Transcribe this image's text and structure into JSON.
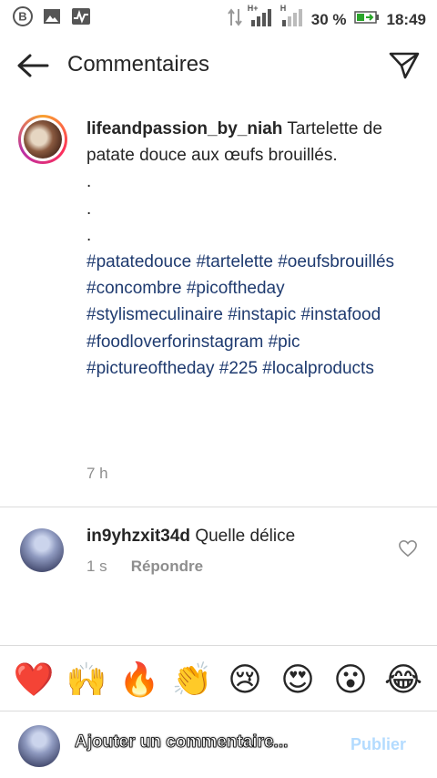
{
  "status_bar": {
    "battery_percent": "30 %",
    "time": "18:49",
    "network_1": "H+",
    "network_2": "H"
  },
  "header": {
    "title": "Commentaires"
  },
  "post": {
    "username": "lifeandpassion_by_niah",
    "caption": "Tartelette de patate douce aux œufs brouillés.",
    "dots": [
      ".",
      ".",
      "."
    ],
    "hashtags": "#patatedouce #tartelette #oeufsbrouillés #concombre #picoftheday #stylismeculinaire #instapic #instafood #foodloverforinstagram #pic #pictureoftheday #225 #localproducts",
    "time": "7 h"
  },
  "comment": {
    "username": "in9yhzxit34d",
    "text": "Quelle délice",
    "time": "1 s",
    "reply_label": "Répondre"
  },
  "emoji_bar": [
    "❤️",
    "🙌",
    "🔥",
    "👏",
    "😢",
    "😍",
    "😮",
    "😂"
  ],
  "composer": {
    "placeholder": "Ajouter un commentaire...",
    "publish_label": "Publier"
  },
  "colors": {
    "hashtag": "#1e3a6f",
    "publish": "#b3dbff",
    "divider": "#dbdbdb",
    "muted": "#8e8e8e"
  }
}
